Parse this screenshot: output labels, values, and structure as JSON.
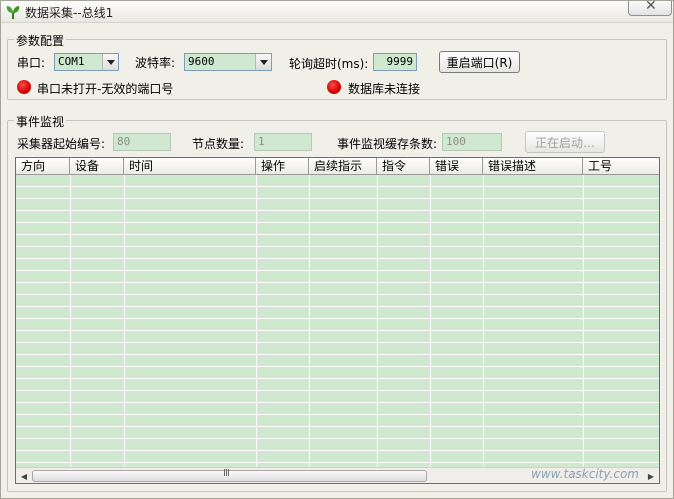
{
  "window": {
    "title": "数据采集--总线1"
  },
  "config": {
    "group_title": "参数配置",
    "port_label": "串口:",
    "port_value": "COM1",
    "baud_label": "波特率:",
    "baud_value": "9600",
    "timeout_label": "轮询超时(ms):",
    "timeout_value": "9999",
    "restart_button": "重启端口(R)",
    "port_status": "串口未打开-无效的端口号",
    "db_status": "数据库未连接",
    "status_color": "#d40000"
  },
  "monitor": {
    "group_title": "事件监视",
    "collector_label": "采集器起始编号:",
    "collector_value": "80",
    "nodes_label": "节点数量:",
    "nodes_value": "1",
    "cache_label": "事件监视缓存条数:",
    "cache_value": "100",
    "starting_button": "正在启动…"
  },
  "table": {
    "columns": [
      "方向",
      "设备",
      "时间",
      "操作",
      "启续指示",
      "指令",
      "错误",
      "错误描述",
      "工号"
    ],
    "row_color": "#cfe8cf"
  },
  "watermark": "www.taskcity.com"
}
